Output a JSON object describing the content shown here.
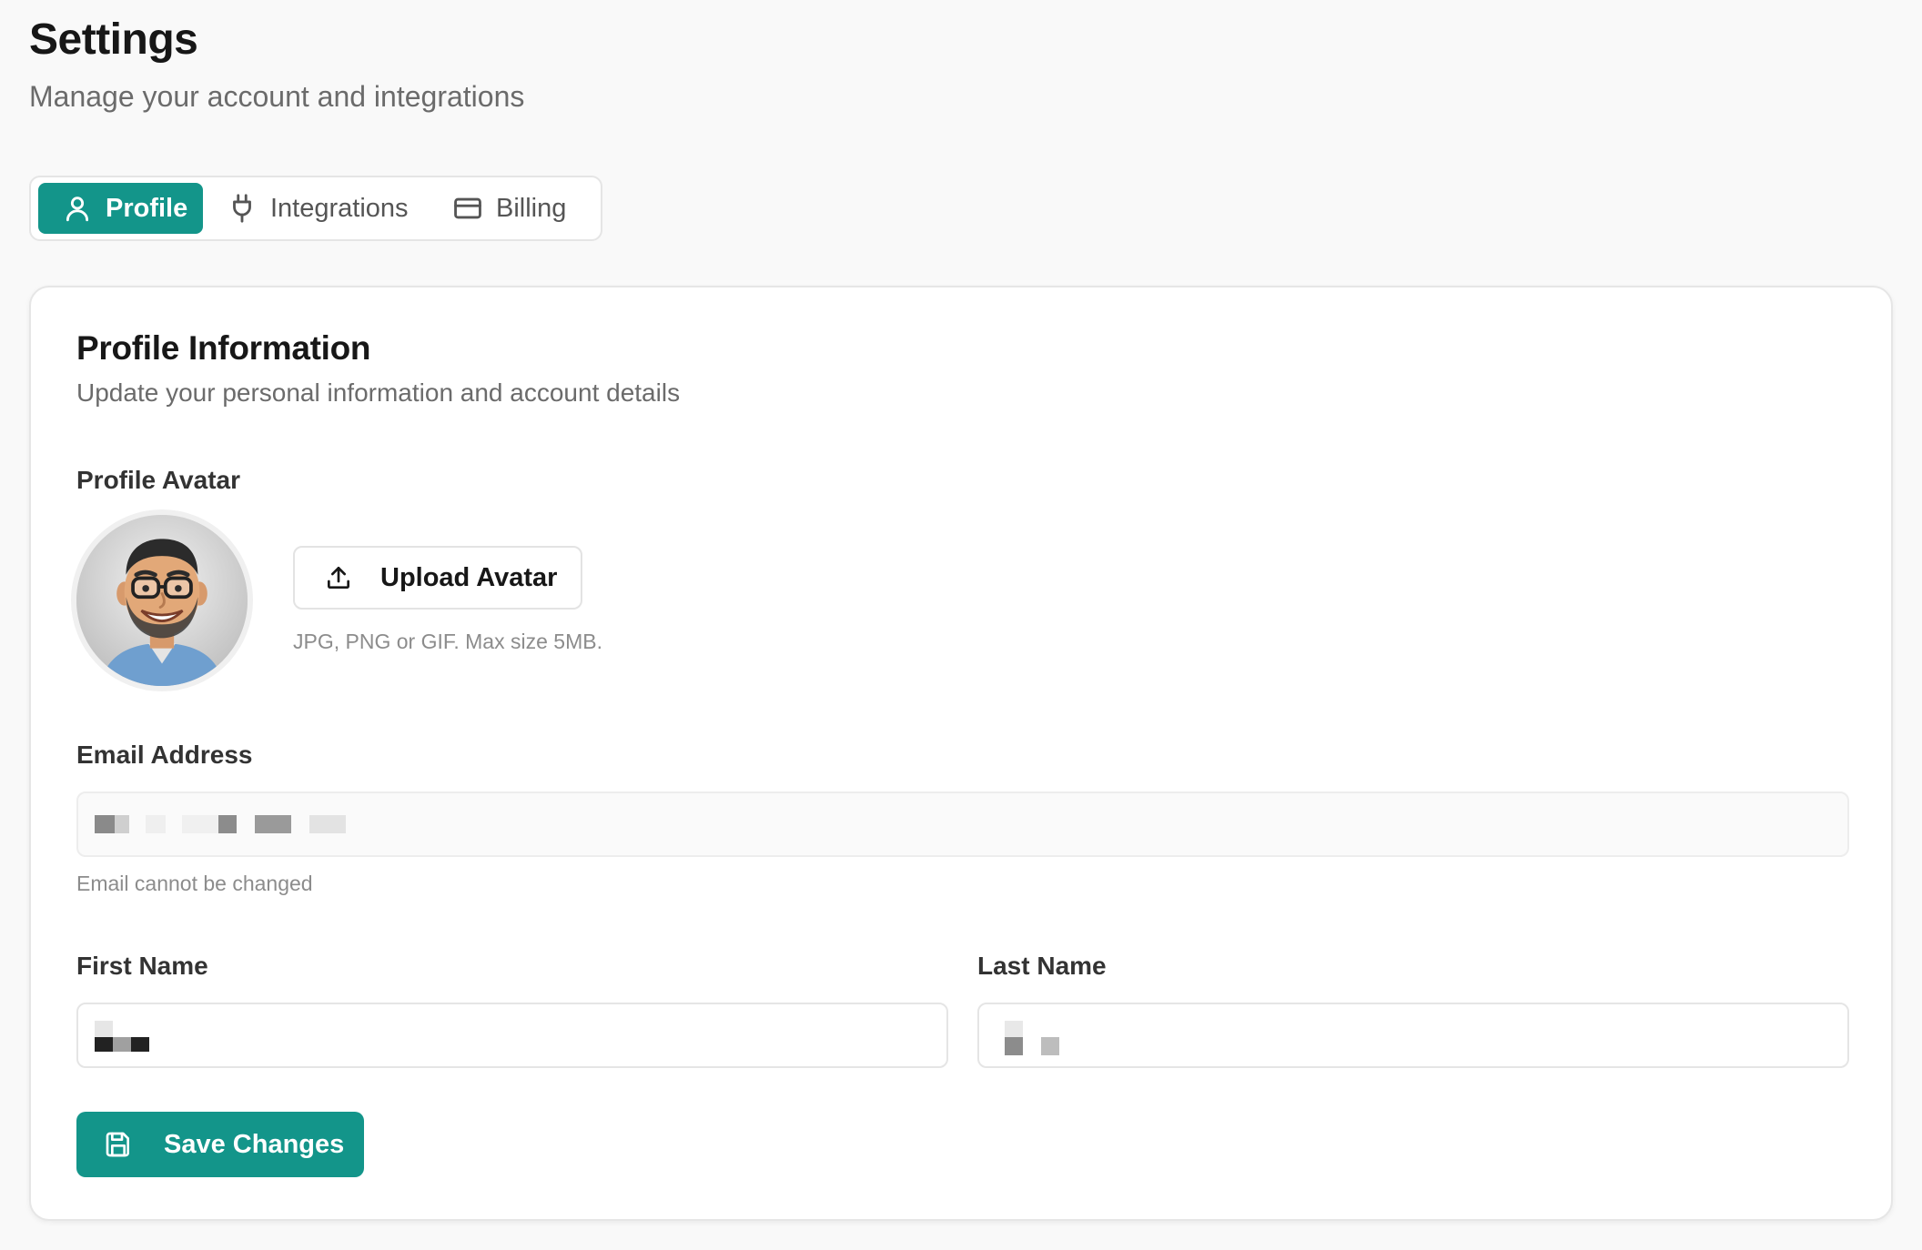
{
  "header": {
    "title": "Settings",
    "subtitle": "Manage your account and integrations"
  },
  "tabs": [
    {
      "label": "Profile",
      "icon": "user-icon",
      "active": true
    },
    {
      "label": "Integrations",
      "icon": "plug-icon",
      "active": false
    },
    {
      "label": "Billing",
      "icon": "credit-card-icon",
      "active": false
    }
  ],
  "profile_card": {
    "title": "Profile Information",
    "subtitle": "Update your personal information and account details",
    "avatar": {
      "label": "Profile Avatar",
      "upload_label": "Upload Avatar",
      "upload_icon": "upload-icon",
      "hint": "JPG, PNG or GIF. Max size 5MB."
    },
    "email": {
      "label": "Email Address",
      "value": "",
      "redacted": true,
      "hint": "Email cannot be changed"
    },
    "first_name": {
      "label": "First Name",
      "value": "",
      "redacted": true
    },
    "last_name": {
      "label": "Last Name",
      "value": "",
      "redacted": true
    },
    "save_label": "Save Changes",
    "save_icon": "save-icon"
  },
  "colors": {
    "accent": "#13958a",
    "background": "#f9f9f9",
    "card": "#ffffff",
    "border": "#e5e5e5",
    "muted_text": "#6b6b6b"
  }
}
